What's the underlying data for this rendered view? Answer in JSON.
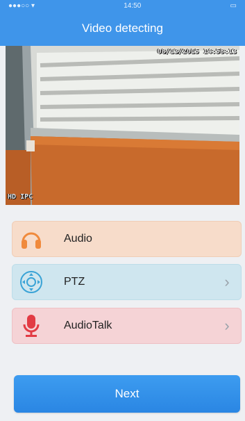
{
  "status_bar": {
    "time": "14:50"
  },
  "nav": {
    "title": "Video detecting"
  },
  "video": {
    "timestamp": "08/13/2015 14:58:13",
    "overlay_hd": "HD",
    "overlay_ipc": "IPC",
    "sticker": "IPC"
  },
  "options": [
    {
      "label": "Audio",
      "icon": "headphones-icon",
      "color": "#f08a3c",
      "chevron": ""
    },
    {
      "label": "PTZ",
      "icon": "ptz-joystick-icon",
      "color": "#3aa3d6",
      "chevron": "›"
    },
    {
      "label": "AudioTalk",
      "icon": "microphone-icon",
      "color": "#e23b44",
      "chevron": "›"
    }
  ],
  "next_button": {
    "label": "Next"
  }
}
